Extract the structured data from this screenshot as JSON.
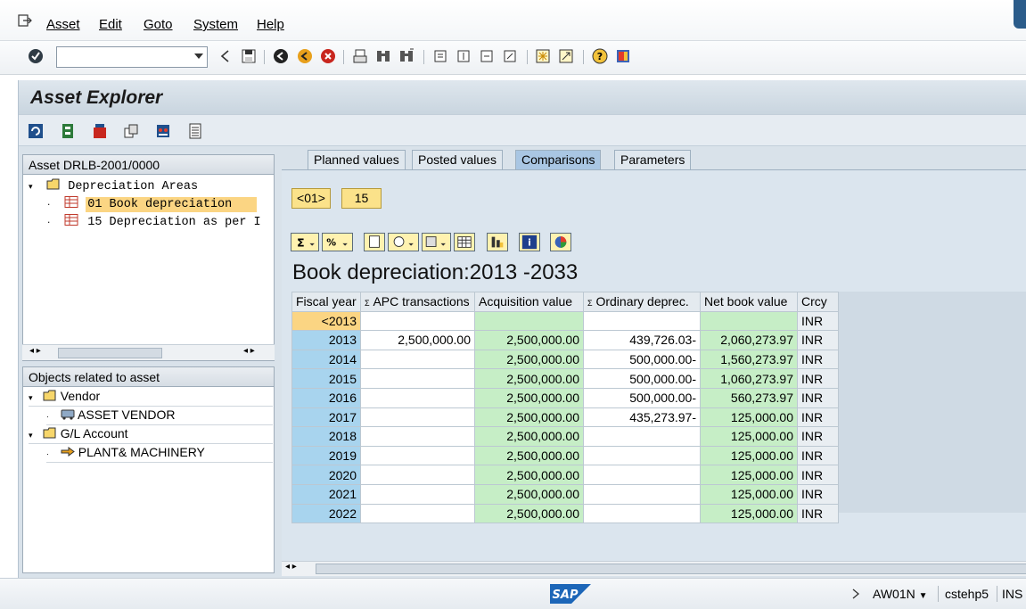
{
  "menu": {
    "items": [
      "Asset",
      "Edit",
      "Goto",
      "System",
      "Help"
    ]
  },
  "toolbar": {
    "command_field_value": ""
  },
  "title": "Asset Explorer",
  "tree_top": {
    "header": "Asset DRLB-2001/0000",
    "root_label": "Depreciation Areas",
    "items": [
      "01 Book depreciation",
      "15 Depreciation as per I"
    ]
  },
  "tree_bottom": {
    "header": "Objects related to asset",
    "vendor_folder": "Vendor",
    "vendor_item": "ASSET VENDOR",
    "gl_folder": "G/L Account",
    "gl_item": "PLANT& MACHINERY"
  },
  "tabs": [
    "Planned values",
    "Posted values",
    "Comparisons",
    "Parameters"
  ],
  "area_buttons": [
    "<01>",
    "15"
  ],
  "report_title": "Book depreciation:2013 -2033",
  "grid": {
    "headers": [
      "Fiscal year",
      "APC transactions",
      "Acquisition value",
      "Ordinary deprec.",
      "Net book value",
      "Crcy"
    ],
    "sigma": "Σ",
    "rows": [
      [
        "<2013",
        "",
        "",
        "",
        "",
        "INR"
      ],
      [
        "2013",
        "2,500,000.00",
        "2,500,000.00",
        "439,726.03-",
        "2,060,273.97",
        "INR"
      ],
      [
        "2014",
        "",
        "2,500,000.00",
        "500,000.00-",
        "1,560,273.97",
        "INR"
      ],
      [
        "2015",
        "",
        "2,500,000.00",
        "500,000.00-",
        "1,060,273.97",
        "INR"
      ],
      [
        "2016",
        "",
        "2,500,000.00",
        "500,000.00-",
        "560,273.97",
        "INR"
      ],
      [
        "2017",
        "",
        "2,500,000.00",
        "435,273.97-",
        "125,000.00",
        "INR"
      ],
      [
        "2018",
        "",
        "2,500,000.00",
        "",
        "125,000.00",
        "INR"
      ],
      [
        "2019",
        "",
        "2,500,000.00",
        "",
        "125,000.00",
        "INR"
      ],
      [
        "2020",
        "",
        "2,500,000.00",
        "",
        "125,000.00",
        "INR"
      ],
      [
        "2021",
        "",
        "2,500,000.00",
        "",
        "125,000.00",
        "INR"
      ],
      [
        "2022",
        "",
        "2,500,000.00",
        "",
        "125,000.00",
        "INR"
      ]
    ]
  },
  "status": {
    "logo": "SAP",
    "transaction": "AW01N",
    "server": "cstehp5",
    "mode": "INS"
  }
}
